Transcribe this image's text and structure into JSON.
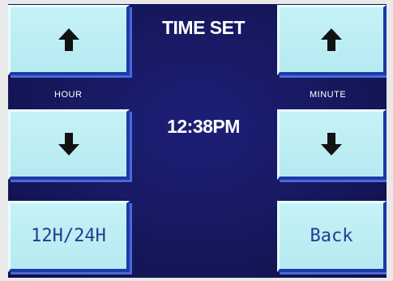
{
  "screen": {
    "title": "TIME SET",
    "time_display": "12:38PM",
    "labels": {
      "hour": "HOUR",
      "minute": "MINUTE"
    },
    "buttons": {
      "hour_up": {
        "icon": "arrow-up-icon"
      },
      "hour_down": {
        "icon": "arrow-down-icon"
      },
      "minute_up": {
        "icon": "arrow-up-icon"
      },
      "minute_down": {
        "icon": "arrow-down-icon"
      },
      "mode_toggle": {
        "label": "12H/24H"
      },
      "back": {
        "label": "Back"
      }
    }
  },
  "colors": {
    "screen_background": "#16185e",
    "button_face": "#bdeef4",
    "button_text": "#1f3f8f",
    "text": "#ffffff"
  }
}
